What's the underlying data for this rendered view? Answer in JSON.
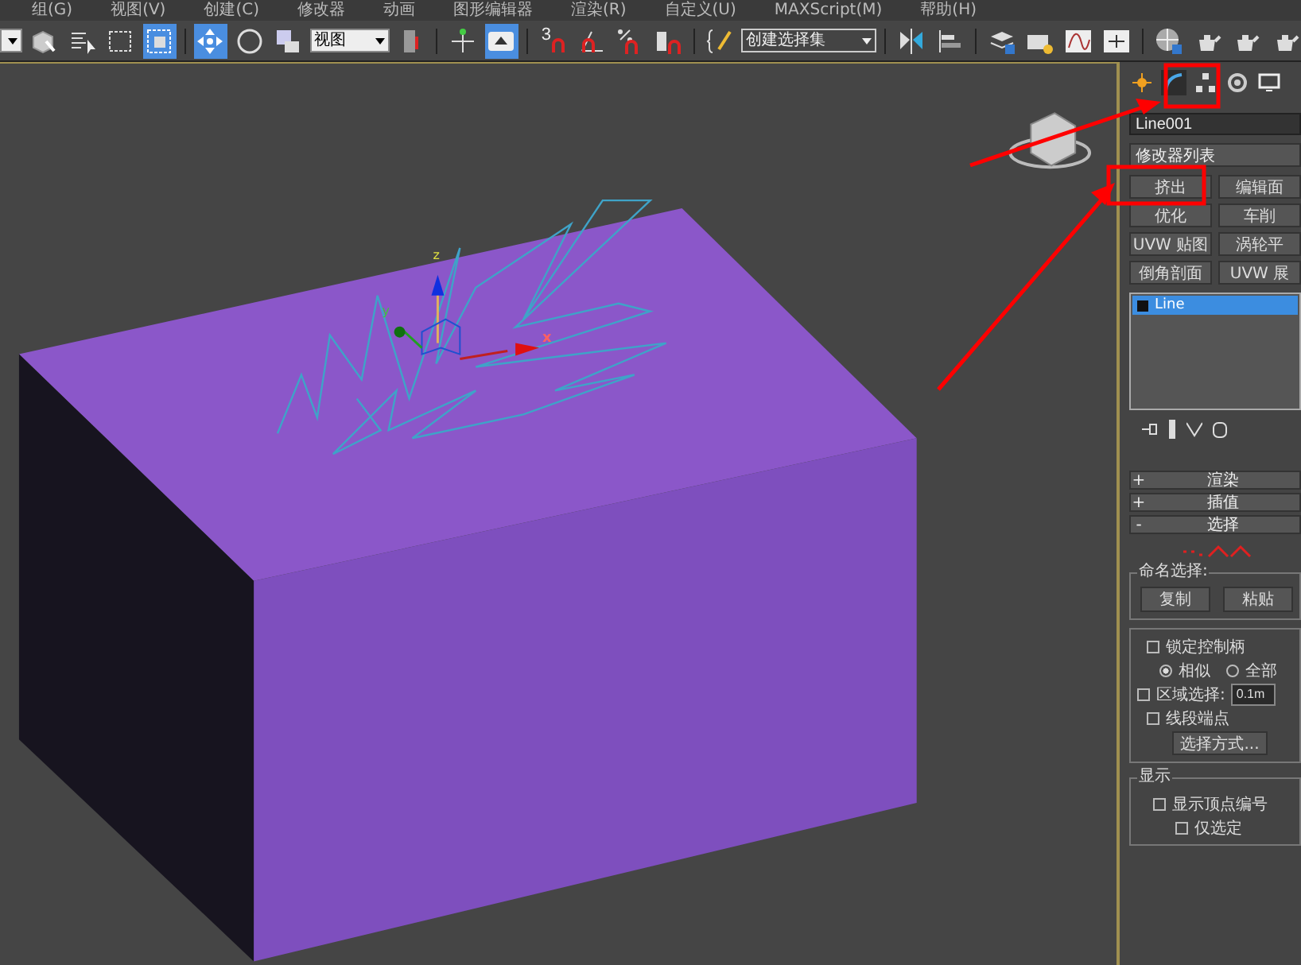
{
  "menu": [
    "组(G)",
    "视图(V)",
    "创建(C)",
    "修改器",
    "动画",
    "图形编辑器",
    "渲染(R)",
    "自定义(U)",
    "MAXScript(M)",
    "帮助(H)"
  ],
  "toolbar": {
    "buttons": [
      {
        "selected": false
      },
      {
        "selected": false
      },
      {
        "selected": false
      },
      {
        "selected": true
      },
      {
        "selected": true
      },
      {
        "selected": false
      },
      {
        "selected": false
      },
      {
        "selected": false
      },
      {
        "selected": true
      }
    ],
    "view_dropdown": "视图",
    "snap_label": "3",
    "selection_set_dropdown": "创建选择集"
  },
  "viewport": {
    "gizmo": {
      "x_label": "x",
      "y_label": "y",
      "z_label": "z"
    }
  },
  "command_tabs": [
    {
      "selected": false
    },
    {
      "selected": true
    },
    {
      "selected": false
    },
    {
      "selected": false
    },
    {
      "selected": false
    }
  ],
  "object_name": "Line001",
  "modifier_list": "修改器列表",
  "modifier_buttons": [
    "挤出",
    "编辑面",
    "优化",
    "车削",
    "UVW 贴图",
    "涡轮平",
    "倒角剖面",
    "UVW 展"
  ],
  "stack": [
    {
      "label": "Line",
      "selected": true
    }
  ],
  "rollouts": [
    {
      "sign": "+",
      "title": "渲染"
    },
    {
      "sign": "+",
      "title": "插值"
    },
    {
      "sign": "-",
      "title": "选择"
    }
  ],
  "named_selection": {
    "title": "命名选择:",
    "buttons": [
      "复制",
      "粘贴"
    ]
  },
  "options": [
    {
      "kind": "checkbox",
      "label": "锁定控制柄",
      "checked": false
    },
    {
      "kind": "radios",
      "items": [
        {
          "label": "相似",
          "selected": true
        },
        {
          "label": "全部",
          "selected": false
        }
      ]
    },
    {
      "kind": "field",
      "label": "区域选择:",
      "checked": false,
      "value": "0.1m"
    },
    {
      "kind": "checkbox",
      "label": "线段端点",
      "checked": false
    },
    {
      "kind": "button",
      "label": "选择方式..."
    }
  ],
  "display": {
    "title": "显示",
    "options": [
      {
        "label": "显示顶点编号",
        "checked": false
      },
      {
        "label": "仅选定",
        "checked": false
      }
    ]
  }
}
